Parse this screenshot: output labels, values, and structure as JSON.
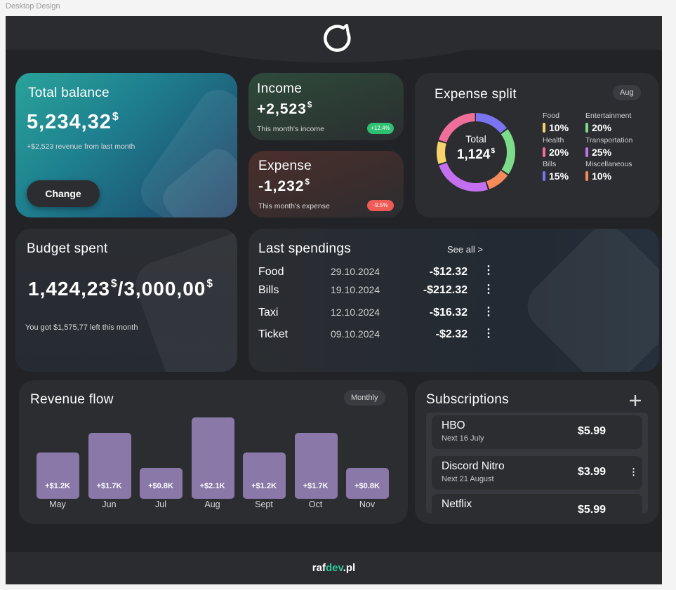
{
  "frame_label": "Desktop Design",
  "balance": {
    "title": "Total balance",
    "amount": "5,234,32",
    "currency": "$",
    "subtitle": "+$2,523 revenue from last month",
    "button": "Change"
  },
  "income": {
    "title": "Income",
    "amount": "+2,523",
    "currency": "$",
    "subtitle": "This month's income",
    "badge": "+12.4%",
    "badge_color": "#2fbf71"
  },
  "expense": {
    "title": "Expense",
    "amount": "-1,232",
    "currency": "$",
    "subtitle": "This month's expense",
    "badge": "-9.5%",
    "badge_color": "#ef5b57"
  },
  "expense_split": {
    "title": "Expense split",
    "period": "Aug",
    "center_label": "Total",
    "center_value": "1,124",
    "currency": "$",
    "categories": [
      {
        "name": "Food",
        "value": "10%",
        "color": "#f7d36b"
      },
      {
        "name": "Entertainment",
        "value": "20%",
        "color": "#7ddc8a"
      },
      {
        "name": "Health",
        "value": "20%",
        "color": "#f06f9a"
      },
      {
        "name": "Transportation",
        "value": "25%",
        "color": "#c46ff0"
      },
      {
        "name": "Bills",
        "value": "15%",
        "color": "#7b74f0"
      },
      {
        "name": "Miscellaneous",
        "value": "10%",
        "color": "#f58b5a"
      }
    ]
  },
  "budget": {
    "title": "Budget spent",
    "spent": "1,424,23",
    "total": "3,000,00",
    "currency": "$",
    "separator": "/",
    "subtitle": "You got $1,575,77 left this month"
  },
  "spendings": {
    "title": "Last spendings",
    "see_all": "See all >",
    "rows": [
      {
        "category": "Food",
        "date": "29.10.2024",
        "amount": "-$12.32"
      },
      {
        "category": "Bills",
        "date": "19.10.2024",
        "amount": "-$212.32"
      },
      {
        "category": "Taxi",
        "date": "12.10.2024",
        "amount": "-$16.32"
      },
      {
        "category": "Ticket",
        "date": "09.10.2024",
        "amount": "-$2.32"
      }
    ]
  },
  "revenue": {
    "title": "Revenue flow",
    "period": "Monthly"
  },
  "chart_data": {
    "type": "bar",
    "title": "Revenue flow",
    "categories": [
      "May",
      "Jun",
      "Jul",
      "Aug",
      "Sept",
      "Oct",
      "Nov"
    ],
    "values": [
      1.2,
      1.7,
      0.8,
      2.1,
      1.2,
      1.7,
      0.8
    ],
    "data_labels": [
      "+$1.2K",
      "+$1.7K",
      "+$0.8K",
      "+$2.1K",
      "+$1.2K",
      "+$1.7K",
      "+$0.8K"
    ],
    "ylim": [
      0,
      2.1
    ],
    "grid": false,
    "bar_color": "#8a78a8"
  },
  "subscriptions": {
    "title": "Subscriptions",
    "items": [
      {
        "name": "HBO",
        "next": "Next 16 July",
        "price": "$5.99"
      },
      {
        "name": "Discord Nitro",
        "next": "Next 21 August",
        "price": "$3.99"
      },
      {
        "name": "Netflix",
        "next": "",
        "price": "$5.99"
      }
    ]
  },
  "footer": {
    "brand_prefix": "raf",
    "brand_accent": "dev",
    "brand_suffix": ".pl"
  }
}
